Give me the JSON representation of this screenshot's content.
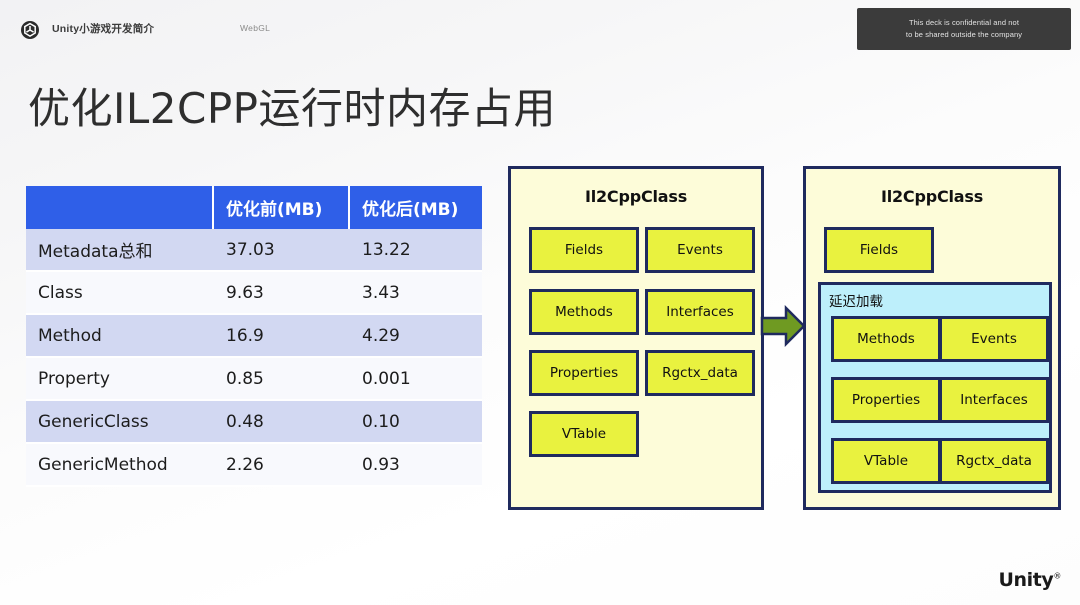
{
  "header": {
    "deck_name": "Unity小游戏开发简介",
    "section_label": "WebGL",
    "logo_icon": "unity-cube-icon",
    "confidential_line1": "This deck is confidential and not",
    "confidential_line2": "to be shared outside the company"
  },
  "title": "优化IL2CPP运行时内存占用",
  "table": {
    "columns": [
      "",
      "优化前(MB)",
      "优化后(MB)"
    ],
    "rows": [
      {
        "name": "Metadata总和",
        "before": "37.03",
        "after": "13.22"
      },
      {
        "name": "Class",
        "before": "9.63",
        "after": "3.43"
      },
      {
        "name": "Method",
        "before": "16.9",
        "after": "4.29"
      },
      {
        "name": "Property",
        "before": "0.85",
        "after": "0.001"
      },
      {
        "name": "GenericClass",
        "before": "0.48",
        "after": "0.10"
      },
      {
        "name": "GenericMethod",
        "before": "2.26",
        "after": "0.93"
      }
    ]
  },
  "diagram": {
    "arrow_icon": "right-arrow-icon",
    "before": {
      "title": "Il2CppClass",
      "chips": [
        "Fields",
        "Events",
        "Methods",
        "Interfaces",
        "Properties",
        "Rgctx_data",
        "VTable"
      ]
    },
    "after": {
      "title": "Il2CppClass",
      "eager_chips": [
        "Fields"
      ],
      "lazy_label": "延迟加载",
      "lazy_chips": [
        "Methods",
        "Events",
        "Properties",
        "Interfaces",
        "VTable",
        "Rgctx_data"
      ]
    }
  },
  "footer": {
    "wordmark": "Unity",
    "registered_mark": "®"
  },
  "colors": {
    "table_header_blue": "#2f5fe8",
    "table_row_tint": "#d2d8f2",
    "table_row_plain": "#f8f9fd",
    "panel_fill": "#fdfcd9",
    "panel_border": "#1f2a5e",
    "chip_fill": "#e9f23f",
    "lazy_fill": "#bdeffb",
    "arrow_fill": "#6f9a22",
    "confidential_bg": "#3b3b3b",
    "title_color": "#2e2e2e"
  }
}
